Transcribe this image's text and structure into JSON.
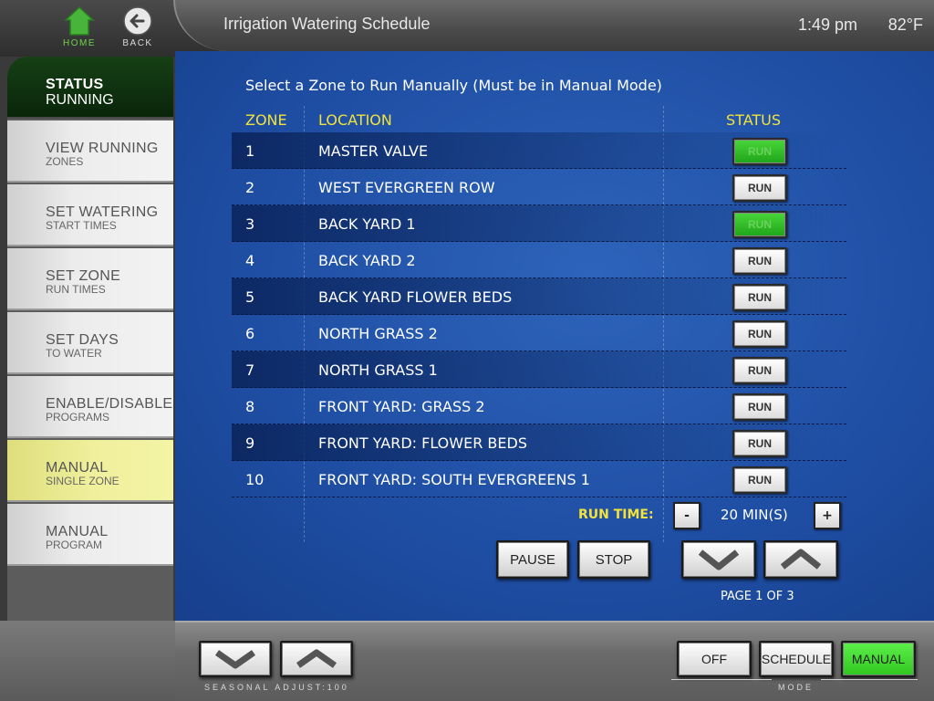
{
  "header": {
    "home_label": "HOME",
    "back_label": "BACK",
    "title": "Irrigation Watering Schedule",
    "time": "1:49 pm",
    "temperature": "82°F"
  },
  "sidebar": {
    "items": [
      {
        "main": "STATUS",
        "sub": "RUNNING"
      },
      {
        "main": "VIEW RUNNING",
        "sub": "ZONES"
      },
      {
        "main": "SET WATERING",
        "sub": "START TIMES"
      },
      {
        "main": "SET ZONE",
        "sub": "RUN TIMES"
      },
      {
        "main": "SET DAYS",
        "sub": "TO WATER"
      },
      {
        "main": "ENABLE/DISABLE",
        "sub": "PROGRAMS"
      },
      {
        "main": "MANUAL",
        "sub": "SINGLE ZONE"
      },
      {
        "main": "MANUAL",
        "sub": "PROGRAM"
      }
    ],
    "active_index": 6
  },
  "main": {
    "instruction": "Select a Zone to Run Manually (Must be in Manual Mode)",
    "columns": {
      "zone": "ZONE",
      "location": "LOCATION",
      "status": "STATUS"
    },
    "zones": [
      {
        "zone": "1",
        "location": "MASTER VALVE",
        "button": "RUN",
        "running": true
      },
      {
        "zone": "2",
        "location": "WEST EVERGREEN ROW",
        "button": "RUN",
        "running": false
      },
      {
        "zone": "3",
        "location": "BACK YARD 1",
        "button": "RUN",
        "running": true
      },
      {
        "zone": "4",
        "location": "BACK YARD 2",
        "button": "RUN",
        "running": false
      },
      {
        "zone": "5",
        "location": "BACK YARD FLOWER BEDS",
        "button": "RUN",
        "running": false
      },
      {
        "zone": "6",
        "location": "NORTH GRASS 2",
        "button": "RUN",
        "running": false
      },
      {
        "zone": "7",
        "location": "NORTH GRASS 1",
        "button": "RUN",
        "running": false
      },
      {
        "zone": "8",
        "location": "FRONT YARD: GRASS 2",
        "button": "RUN",
        "running": false
      },
      {
        "zone": "9",
        "location": "FRONT YARD: FLOWER BEDS",
        "button": "RUN",
        "running": false
      },
      {
        "zone": "10",
        "location": "FRONT YARD: SOUTH EVERGREENS 1",
        "button": "RUN",
        "running": false
      }
    ],
    "run_time": {
      "label": "RUN TIME:",
      "minus": "-",
      "plus": "+",
      "value": "20 MIN(S)"
    },
    "pause_label": "PAUSE",
    "stop_label": "STOP",
    "page_indicator": "PAGE 1 OF 3"
  },
  "footer": {
    "seasonal_adjust_label": "SEASONAL ADJUST:100",
    "mode_label": "MODE",
    "modes": {
      "off": "OFF",
      "schedule": "SCHEDULE",
      "manual": "MANUAL"
    },
    "active_mode": "manual"
  },
  "colors": {
    "accent_yellow": "#f2e23a",
    "run_green": "#1fa41a",
    "home_green": "#6fd04a",
    "panel_blue": "#1f4fa5",
    "active_tab_yellow": "#efef9c",
    "status_dark_green": "#0a250a"
  }
}
